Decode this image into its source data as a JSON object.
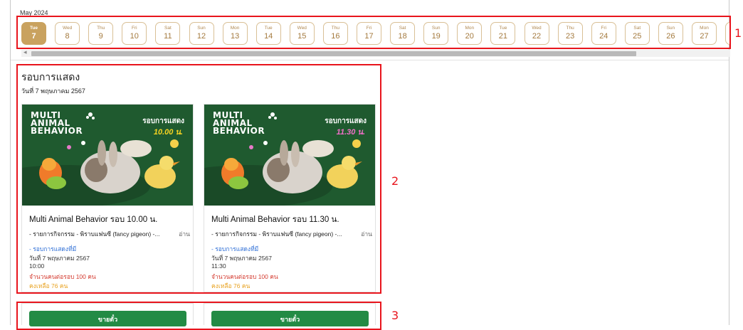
{
  "month_label": "May 2024",
  "dates": [
    {
      "dow": "Tue",
      "day": "7",
      "active": true
    },
    {
      "dow": "Wed",
      "day": "8",
      "active": false
    },
    {
      "dow": "Thu",
      "day": "9",
      "active": false
    },
    {
      "dow": "Fri",
      "day": "10",
      "active": false
    },
    {
      "dow": "Sat",
      "day": "11",
      "active": false
    },
    {
      "dow": "Sun",
      "day": "12",
      "active": false
    },
    {
      "dow": "Mon",
      "day": "13",
      "active": false
    },
    {
      "dow": "Tue",
      "day": "14",
      "active": false
    },
    {
      "dow": "Wed",
      "day": "15",
      "active": false
    },
    {
      "dow": "Thu",
      "day": "16",
      "active": false
    },
    {
      "dow": "Fri",
      "day": "17",
      "active": false
    },
    {
      "dow": "Sat",
      "day": "18",
      "active": false
    },
    {
      "dow": "Sun",
      "day": "19",
      "active": false
    },
    {
      "dow": "Mon",
      "day": "20",
      "active": false
    },
    {
      "dow": "Tue",
      "day": "21",
      "active": false
    },
    {
      "dow": "Wed",
      "day": "22",
      "active": false
    },
    {
      "dow": "Thu",
      "day": "23",
      "active": false
    },
    {
      "dow": "Fri",
      "day": "24",
      "active": false
    },
    {
      "dow": "Sat",
      "day": "25",
      "active": false
    },
    {
      "dow": "Sun",
      "day": "26",
      "active": false
    },
    {
      "dow": "Mon",
      "day": "27",
      "active": false
    }
  ],
  "section": {
    "title": "รอบการแสดง",
    "date": "วันที่ 7 พฤษภาคม 2567"
  },
  "cards": [
    {
      "banner_logo": [
        "MULTI",
        "ANIMAL",
        "BEHAVIOR"
      ],
      "banner_label": "รอบการแสดง",
      "banner_time": "10.00 น.",
      "banner_time_color": "#f5d321",
      "title": "Multi Animal Behavior รอบ 10.00 น.",
      "desc": "- รายการกิจกรรม - พิราบแฟนซี (fancy pigeon) -...",
      "more": "อ่าน",
      "link": "- รอบการแสดงที่มี",
      "date": "วันที่ 7 พฤษภาคม 2567",
      "time": "10:00",
      "capacity": "จำนวนคนต่อรอบ 100 คน",
      "remaining": "คงเหลือ 76 คน",
      "buy": "ขายตั๋ว"
    },
    {
      "banner_logo": [
        "MULTI",
        "ANIMAL",
        "BEHAVIOR"
      ],
      "banner_label": "รอบการแสดง",
      "banner_time": "11.30 น.",
      "banner_time_color": "#f06fc8",
      "title": "Multi Animal Behavior รอบ 11.30 น.",
      "desc": "- รายการกิจกรรม - พิราบแฟนซี (fancy pigeon) -...",
      "more": "อ่าน",
      "link": "- รอบการแสดงที่มี",
      "date": "วันที่ 7 พฤษภาคม 2567",
      "time": "11:30",
      "capacity": "จำนวนคนต่อรอบ 100 คน",
      "remaining": "คงเหลือ 76 คน",
      "buy": "ขายตั๋ว"
    }
  ],
  "annotations": [
    "1",
    "2",
    "3"
  ],
  "colors": {
    "accent_gold": "#c9a25f",
    "highlight_red": "#e8141c",
    "buy_green": "#238b45",
    "banner_green": "#1f5a2f"
  }
}
